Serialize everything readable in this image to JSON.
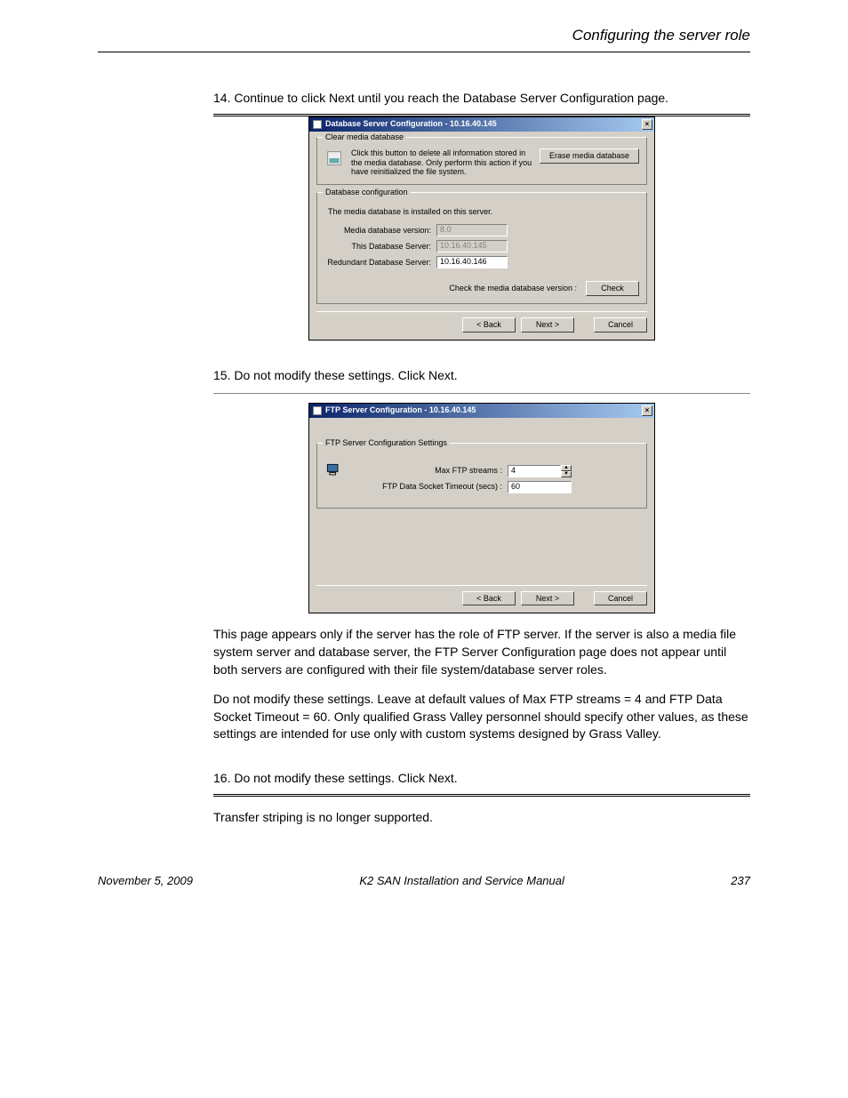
{
  "header": {
    "right": "Configuring the server role"
  },
  "steps": {
    "s14": "14. Continue to click Next until you reach the Database Server Configuration page.",
    "s15": "15. Do not modify these settings. Click Next.",
    "s16": "16. Do not modify these settings. Click Next."
  },
  "dialog1": {
    "title": "Database Server Configuration - 10.16.40.145",
    "group_clear": "Clear media database",
    "clear_text": "Click this button to delete all information stored in the media database. Only perform this action if you have reinitialized the file system.",
    "erase_btn": "Erase media database",
    "group_config": "Database configuration",
    "installed_text": "The media database is installed on this server.",
    "label_version": "Media database version:",
    "version_value": "8.0",
    "label_this": "This Database Server:",
    "this_value": "10.16.40.145",
    "label_redundant": "Redundant Database Server:",
    "redundant_value": "10.16.40.146",
    "check_label": "Check the media database version :",
    "check_btn": "Check",
    "back": "< Back",
    "next": "Next >",
    "cancel": "Cancel"
  },
  "dialog2": {
    "title": "FTP Server Configuration - 10.16.40.145",
    "group": "FTP Server Configuration Settings",
    "label_max": "Max FTP streams :",
    "max_value": "4",
    "label_timeout": "FTP Data Socket Timeout (secs) :",
    "timeout_value": "60",
    "back": "< Back",
    "next": "Next >",
    "cancel": "Cancel"
  },
  "body_text": {
    "p1_a": "This page appears only if the server has the role of FTP server. If the server is also a media file system server and database server, the FTP Server Configuration page does not appear until both servers are configured with their file system/database server roles.",
    "p2_a": "Do not modify these settings. Leave at default values of Max FTP streams = 4 and FTP Data Socket Timeout = 60. Only qualified Grass Valley personnel should specify other values, as these settings are intended for use only with custom systems designed by Grass Valley.",
    "p3_a": "Transfer striping is no longer supported."
  },
  "footer": {
    "left": "November 5, 2009",
    "center": "K2 SAN Installation and Service Manual",
    "right": "237"
  }
}
